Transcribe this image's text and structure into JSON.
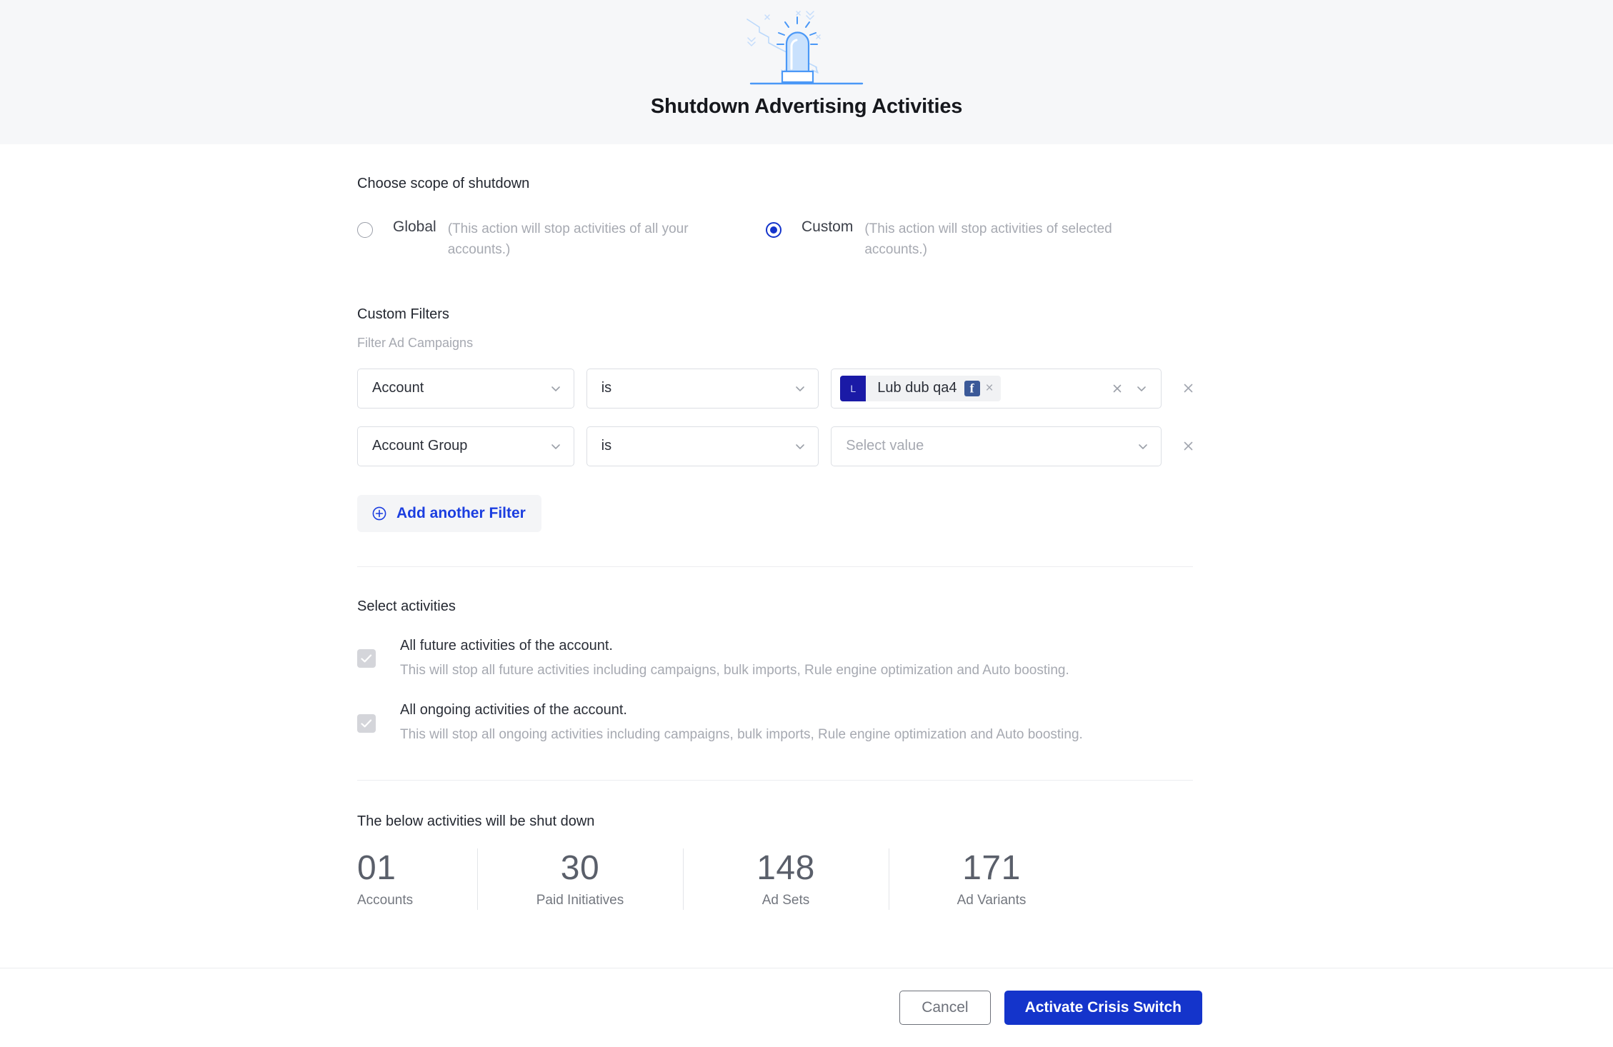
{
  "header": {
    "title": "Shutdown Advertising Activities",
    "illustration": "siren-beacon-illustration"
  },
  "scope": {
    "label": "Choose scope of shutdown",
    "options": [
      {
        "name": "Global",
        "description": "(This action will stop activities of all your accounts.)",
        "selected": false
      },
      {
        "name": "Custom",
        "description": "(This action will stop activities of selected accounts.)",
        "selected": true
      }
    ]
  },
  "filters": {
    "title": "Custom Filters",
    "subtitle": "Filter Ad Campaigns",
    "rows": [
      {
        "key": "Account",
        "operator": "is",
        "value_chip": {
          "avatar_letter": "L",
          "label": "Lub dub qa4",
          "platform_icon": "facebook-icon"
        }
      },
      {
        "key": "Account Group",
        "operator": "is",
        "value_placeholder": "Select value"
      }
    ],
    "add_button": "Add another Filter"
  },
  "activities": {
    "title": "Select activities",
    "items": [
      {
        "title": "All future activities of the account.",
        "description": "This will stop all future activities including campaigns, bulk imports, Rule engine optimization and Auto boosting.",
        "checked": true
      },
      {
        "title": "All ongoing activities of the account.",
        "description": "This will stop all ongoing activities including campaigns, bulk imports, Rule engine optimization and Auto boosting.",
        "checked": true
      }
    ]
  },
  "summary": {
    "title": "The below activities will be shut down",
    "stats": [
      {
        "value": "01",
        "label": "Accounts"
      },
      {
        "value": "30",
        "label": "Paid Initiatives"
      },
      {
        "value": "148",
        "label": "Ad Sets"
      },
      {
        "value": "171",
        "label": "Ad Variants"
      }
    ]
  },
  "footer": {
    "cancel_label": "Cancel",
    "primary_label": "Activate Crisis Switch"
  },
  "colors": {
    "accent": "#1434cb",
    "link": "#1b3ee0",
    "header_bg": "#f6f7f9",
    "muted_text": "#a6a9b1"
  }
}
